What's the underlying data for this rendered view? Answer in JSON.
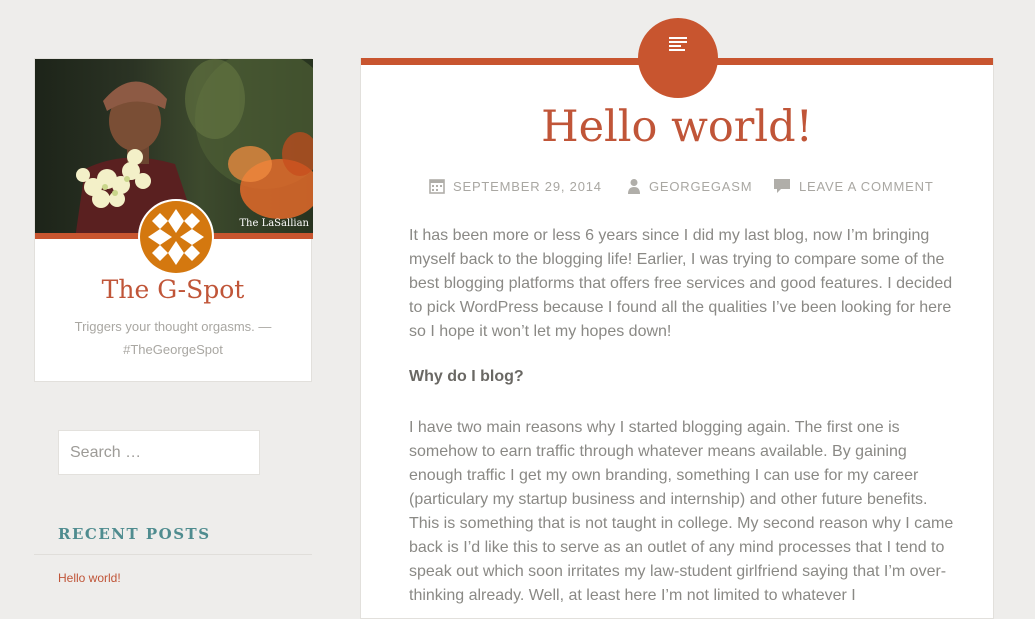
{
  "site": {
    "title": "The G-Spot",
    "tagline": "Triggers your thought orgasms. — #TheGeorgeSpot",
    "photo_credit": "The LaSallian",
    "accent_color": "#c8552f"
  },
  "sidebar": {
    "search_placeholder": "Search …",
    "recent_posts_heading": "RECENT POSTS",
    "recent_posts": [
      "Hello world!"
    ]
  },
  "post": {
    "format_icon": "text-lines-icon",
    "title": "Hello world!",
    "date": "SEPTEMBER 29, 2014",
    "author": "GEORGEGASM",
    "comment_link": "LEAVE A COMMENT",
    "paragraph1": "It has been more or less 6 years since I did my last blog, now I’m bringing myself back to the blogging life! Earlier, I was trying to compare some of the best blogging platforms that offers free services and good features. I decided to pick WordPress because I found all the qualities I’ve been looking for here so I hope it won’t let my hopes down!",
    "subheading": "Why do I blog?",
    "paragraph2": "I have two main reasons why I started blogging again. The first one is somehow to earn traffic through whatever means available. By gaining enough traffic I get my own branding, something I can use for my career (particulary my startup business and internship) and other future benefits. This is something that is not taught in college. My second reason why I came back is I’d like this to serve as an outlet of any mind processes that I tend to speak out which soon irritates my law-student girlfriend saying that I’m over-thinking already. Well, at least here I’m not limited to whatever I"
  }
}
